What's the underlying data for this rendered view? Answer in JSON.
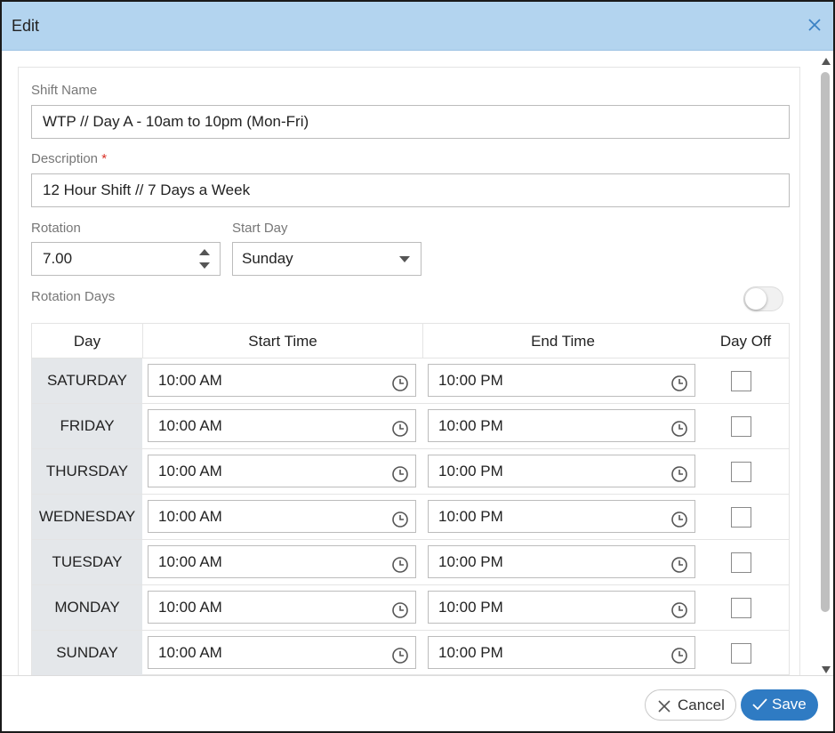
{
  "dialog": {
    "title": "Edit"
  },
  "form": {
    "shift_name": {
      "label": "Shift Name",
      "value": "WTP // Day A - 10am to 10pm (Mon-Fri)"
    },
    "description": {
      "label": "Description",
      "required_mark": "*",
      "value": "12 Hour Shift // 7 Days a Week"
    },
    "rotation": {
      "label": "Rotation",
      "value": "7.00"
    },
    "start_day": {
      "label": "Start Day",
      "value": "Sunday"
    },
    "rotation_days": {
      "label": "Rotation Days",
      "enabled": false
    }
  },
  "table": {
    "headers": {
      "day": "Day",
      "start": "Start Time",
      "end": "End Time",
      "off": "Day Off"
    },
    "rows": [
      {
        "day": "SATURDAY",
        "start": "10:00 AM",
        "end": "10:00 PM",
        "day_off": false
      },
      {
        "day": "FRIDAY",
        "start": "10:00 AM",
        "end": "10:00 PM",
        "day_off": false
      },
      {
        "day": "THURSDAY",
        "start": "10:00 AM",
        "end": "10:00 PM",
        "day_off": false
      },
      {
        "day": "WEDNESDAY",
        "start": "10:00 AM",
        "end": "10:00 PM",
        "day_off": false
      },
      {
        "day": "TUESDAY",
        "start": "10:00 AM",
        "end": "10:00 PM",
        "day_off": false
      },
      {
        "day": "MONDAY",
        "start": "10:00 AM",
        "end": "10:00 PM",
        "day_off": false
      },
      {
        "day": "SUNDAY",
        "start": "10:00 AM",
        "end": "10:00 PM",
        "day_off": false
      }
    ]
  },
  "footer": {
    "cancel_label": "Cancel",
    "save_label": "Save"
  },
  "colors": {
    "titlebar": "#b3d4ef",
    "primary": "#2f7bc3",
    "required": "#d93025",
    "day_column": "#e4e7ea"
  },
  "icons": {
    "close": "close-icon",
    "clock": "clock-icon",
    "cancel": "x-icon",
    "save": "check-icon"
  }
}
